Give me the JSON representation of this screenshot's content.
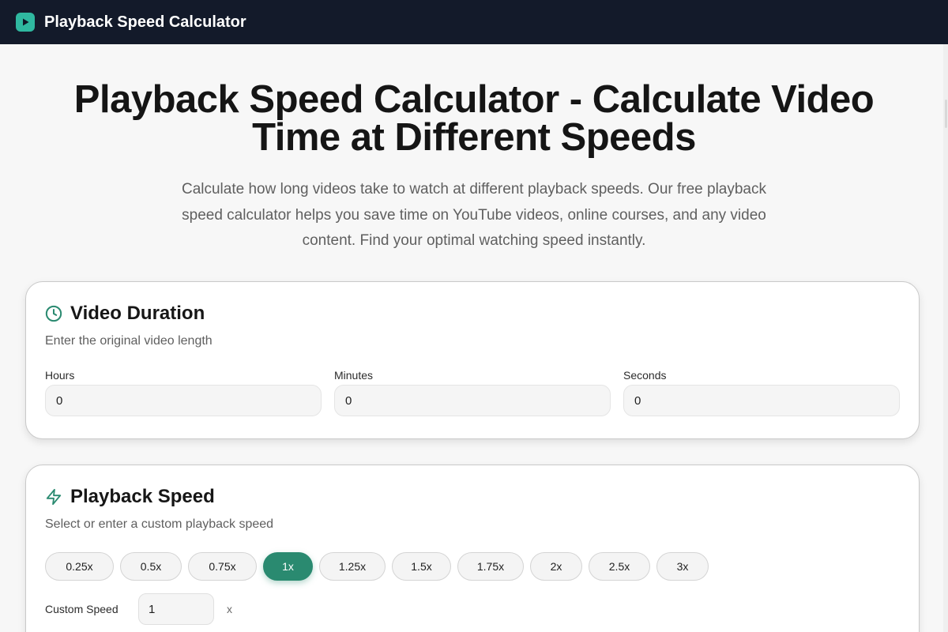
{
  "header": {
    "brand": "Playback Speed Calculator",
    "logo_icon": "play-icon",
    "accent": "#2fb8a0"
  },
  "hero": {
    "title_line1": "Playback Speed Calculator - Calculate Video",
    "title_line2": "Time at Different Speeds",
    "description": "Calculate how long videos take to watch at different playback speeds. Our free playback speed calculator helps you save time on YouTube videos, online courses, and any video content. Find your optimal watching speed instantly."
  },
  "duration_card": {
    "icon": "clock-icon",
    "title": "Video Duration",
    "subtitle": "Enter the original video length",
    "hours_label": "Hours",
    "hours_value": "0",
    "minutes_label": "Minutes",
    "minutes_value": "0",
    "seconds_label": "Seconds",
    "seconds_value": "0"
  },
  "speed_card": {
    "icon": "lightning-icon",
    "title": "Playback Speed",
    "subtitle": "Select or enter a custom playback speed",
    "speeds": [
      "0.25x",
      "0.5x",
      "0.75x",
      "1x",
      "1.25x",
      "1.5x",
      "1.75x",
      "2x",
      "2.5x",
      "3x"
    ],
    "selected": "1x",
    "custom_label": "Custom Speed",
    "custom_value": "1",
    "custom_unit": "x",
    "active_color": "#2a8a70"
  }
}
